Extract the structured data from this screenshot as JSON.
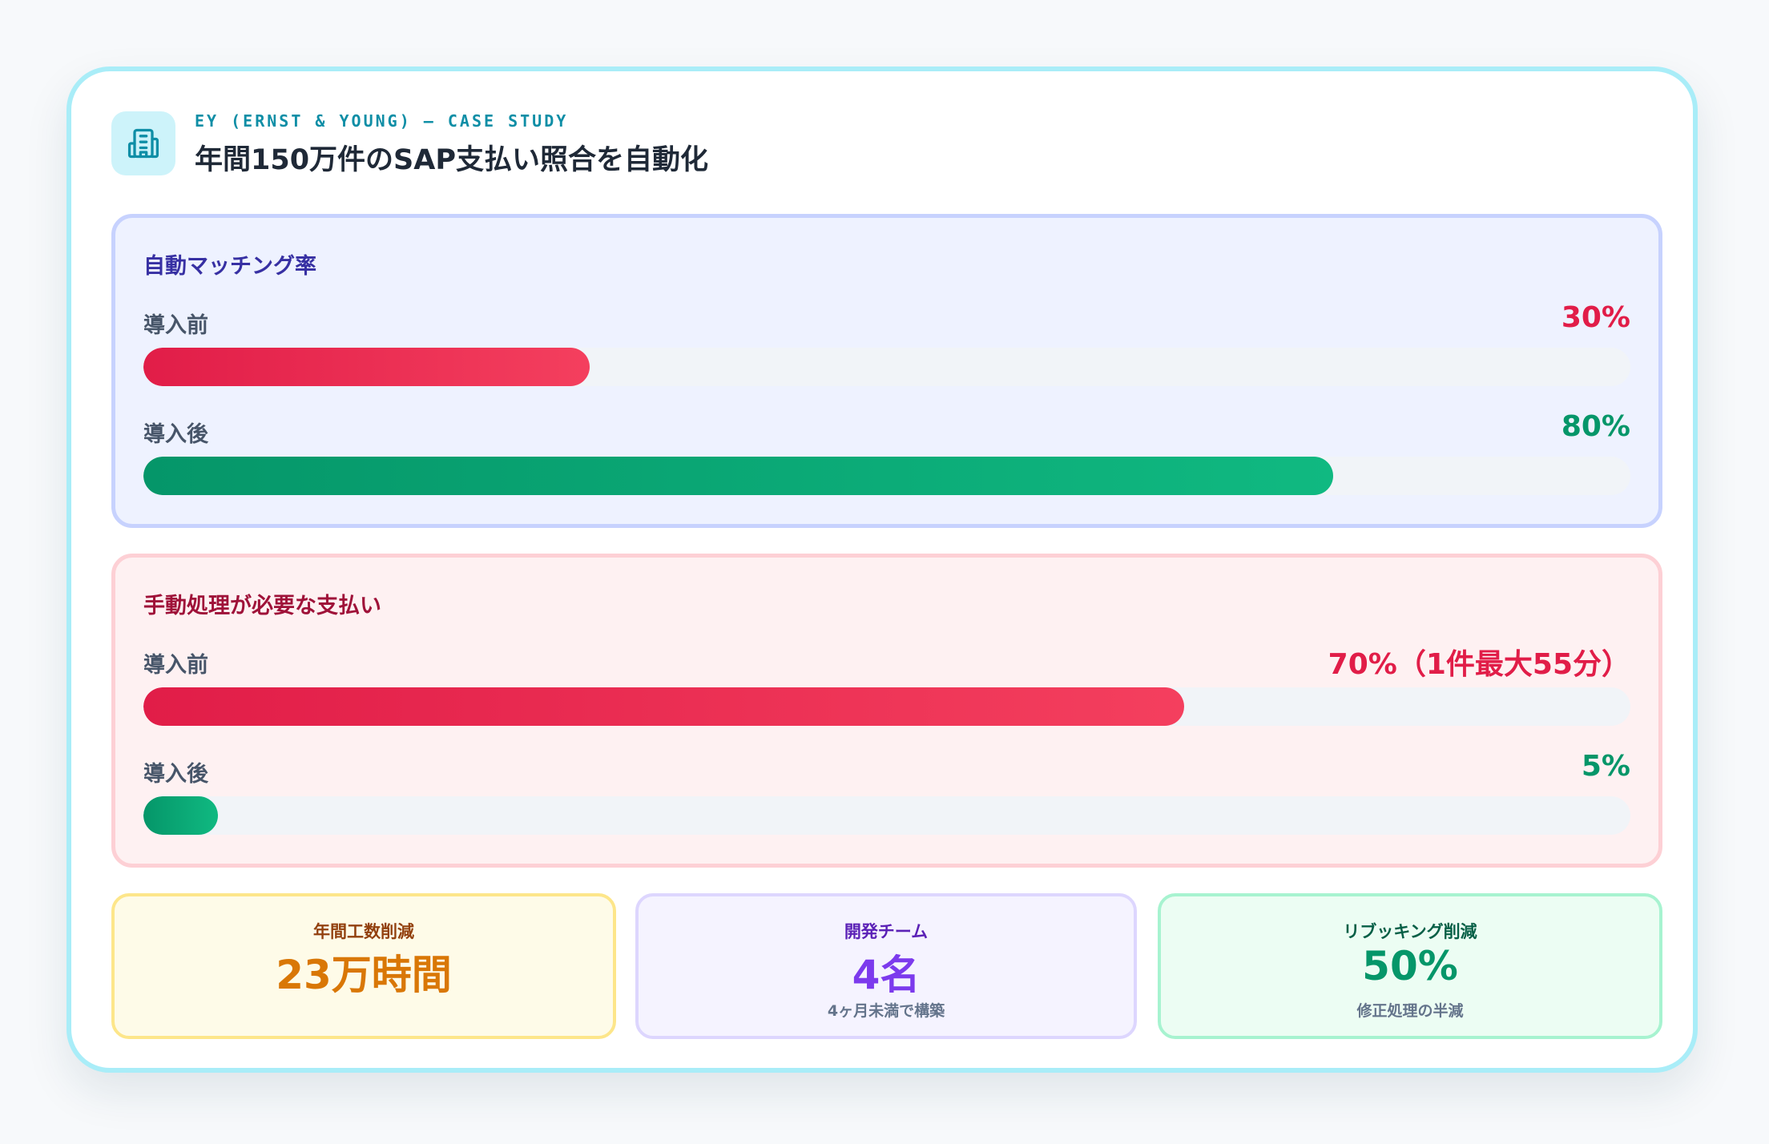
{
  "header": {
    "eyebrow": "EY (ERNST & YOUNG) — CASE STUDY",
    "title": "年間150万件のSAP支払い照合を自動化",
    "icon": "building-icon"
  },
  "colors": {
    "accent": "#0e8ea6",
    "before_red": "#e11d48",
    "after_green": "#059669"
  },
  "matching_rate": {
    "title": "自動マッチング率",
    "before": {
      "label": "導入前",
      "value_text": "30%",
      "percent": 30
    },
    "after": {
      "label": "導入後",
      "value_text": "80%",
      "percent": 80
    }
  },
  "manual_processing": {
    "title": "手動処理が必要な支払い",
    "before": {
      "label": "導入前",
      "value_text": "70%（1件最大55分）",
      "percent": 70
    },
    "after": {
      "label": "導入後",
      "value_text": "5%",
      "percent": 5
    }
  },
  "stats": [
    {
      "label": "年間工数削減",
      "value": "23万時間",
      "sub": ""
    },
    {
      "label": "開発チーム",
      "value": "4名",
      "sub": "4ヶ月未満で構築"
    },
    {
      "label": "リブッキング削減",
      "value": "50%",
      "sub": "修正処理の半減"
    }
  ]
}
